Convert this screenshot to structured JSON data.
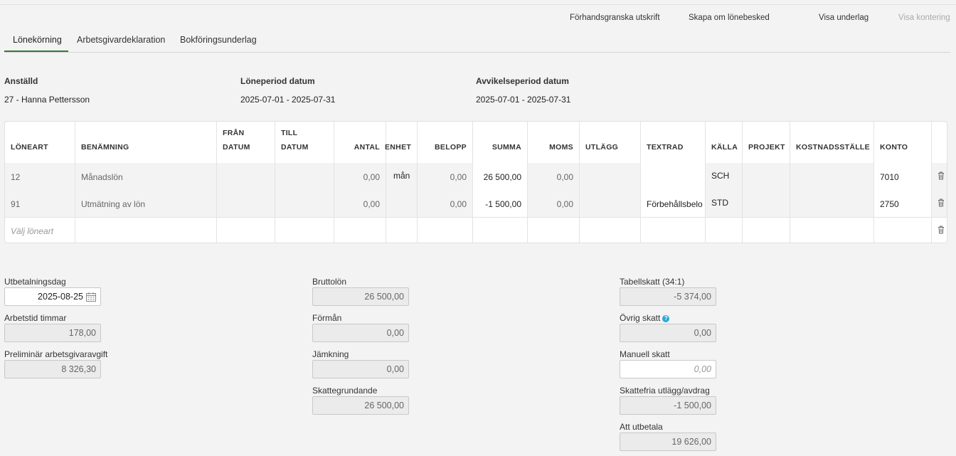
{
  "actions": {
    "preview": "Förhandsgranska utskrift",
    "recreate": "Skapa om lönebesked",
    "show_basis": "Visa underlag",
    "show_posting": "Visa kontering"
  },
  "tabs": [
    "Lönekörning",
    "Arbetsgivardeklaration",
    "Bokföringsunderlag"
  ],
  "info": {
    "employee_label": "Anställd",
    "employee_value": "27 - Hanna Pettersson",
    "period_label": "Löneperiod datum",
    "period_value": "2025-07-01 - 2025-07-31",
    "deviation_label": "Avvikelseperiod datum",
    "deviation_value": "2025-07-01 - 2025-07-31"
  },
  "table": {
    "headers": {
      "loneart": "LÖNEART",
      "benamning": "BENÄMNING",
      "fran1": "FRÅN",
      "fran2": "DATUM",
      "till1": "TILL",
      "till2": "DATUM",
      "antal": "ANTAL",
      "enhet": "ENHET",
      "belopp": "BELOPP",
      "summa": "SUMMA",
      "moms": "MOMS",
      "utlagg": "UTLÄGG",
      "textrad": "TEXTRAD",
      "kalla": "KÄLLA",
      "projekt": "PROJEKT",
      "kostnadsstalle": "KOSTNADSSTÄLLE",
      "konto": "KONTO"
    },
    "rows": [
      {
        "loneart": "12",
        "benamning": "Månadslön",
        "fran": "",
        "till": "",
        "antal": "0,00",
        "enhet": "mån",
        "belopp": "0,00",
        "summa": "26 500,00",
        "moms": "0,00",
        "utlagg": "",
        "textrad": "",
        "kalla": "SCH",
        "projekt": "",
        "kostnadsstalle": "",
        "konto": "7010"
      },
      {
        "loneart": "91",
        "benamning": "Utmätning av lön",
        "fran": "",
        "till": "",
        "antal": "0,00",
        "enhet": "",
        "belopp": "0,00",
        "summa": "-1 500,00",
        "moms": "0,00",
        "utlagg": "",
        "textrad": "Förbehållsbelo",
        "kalla": "STD",
        "projekt": "",
        "kostnadsstalle": "",
        "konto": "2750"
      }
    ],
    "new_row_placeholder": "Välj löneart"
  },
  "form": {
    "payday_label": "Utbetalningsdag",
    "payday_value": "2025-08-25",
    "hours_label": "Arbetstid timmar",
    "hours_value": "178,00",
    "employer_fee_label": "Preliminär arbetsgivaravgift",
    "employer_fee_value": "8 326,30",
    "gross_label": "Bruttolön",
    "gross_value": "26 500,00",
    "benefit_label": "Förmån",
    "benefit_value": "0,00",
    "adjustment_label": "Jämkning",
    "adjustment_value": "0,00",
    "taxable_label": "Skattegrundande",
    "taxable_value": "26 500,00",
    "table_tax_label": "Tabellskatt (34:1)",
    "table_tax_value": "-5 374,00",
    "other_tax_label": "Övrig skatt",
    "other_tax_value": "0,00",
    "manual_tax_label": "Manuell skatt",
    "manual_tax_placeholder": "0,00",
    "taxfree_label": "Skattefria utlägg/avdrag",
    "taxfree_value": "-1 500,00",
    "net_label": "Att utbetala",
    "net_value": "19 626,00"
  },
  "colors": {
    "tab_accent": "#2e7d32",
    "help_icon": "#29a8d8"
  }
}
